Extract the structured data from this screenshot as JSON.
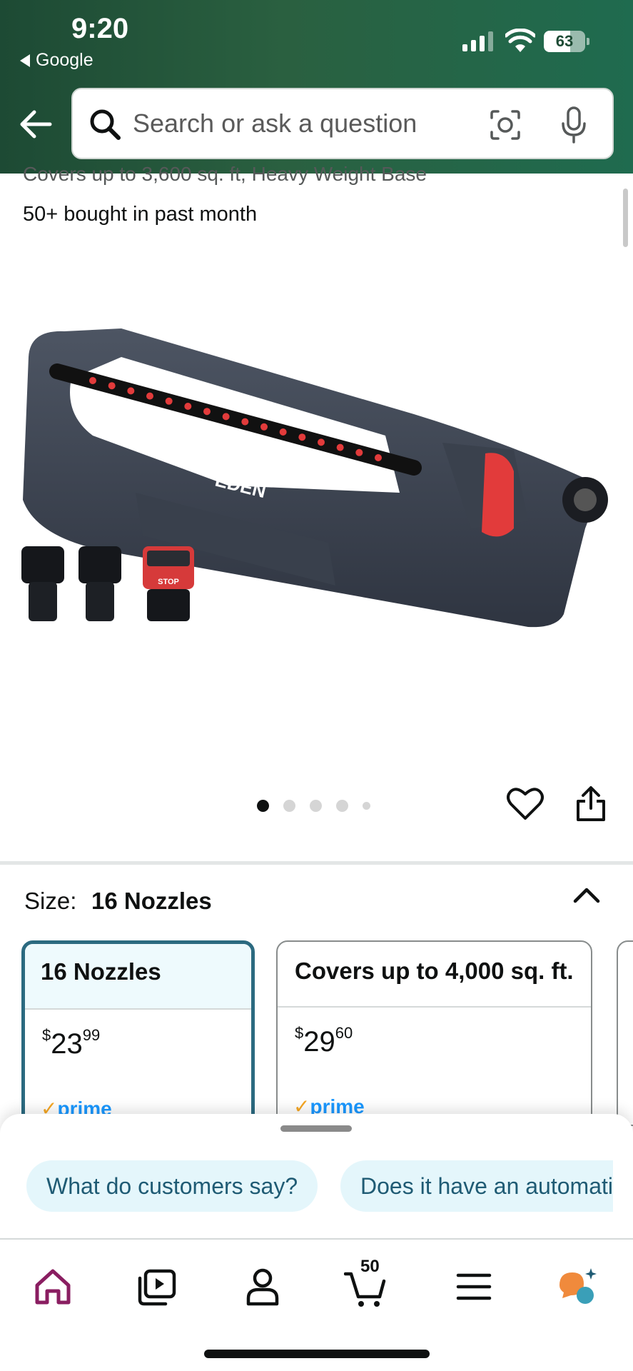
{
  "status_bar": {
    "time": "9:20",
    "back_app": "Google",
    "battery_level": "63",
    "battery_fraction": 0.63,
    "signal_bars_filled": 3
  },
  "search": {
    "placeholder": "Search or ask a question"
  },
  "product": {
    "title_fragment": "Covers up to 3,600 sq. ft, Heavy Weight Base",
    "bought_text": "50+ bought in past month",
    "image_brand": "EDEN",
    "image_badge_text": "STOP",
    "image_count": 5,
    "active_image_index": 0
  },
  "size_selector": {
    "label": "Size:",
    "selected": "16 Nozzles",
    "options": [
      {
        "name": "16 Nozzles",
        "price_whole": "23",
        "price_fraction": "99",
        "currency": "$",
        "prime": "prime",
        "selected": true
      },
      {
        "name": "Covers up to 4,000 sq. ft.",
        "price_whole": "29",
        "price_fraction": "60",
        "currency": "$",
        "prime": "prime",
        "selected": false
      }
    ]
  },
  "suggestions": [
    "What do customers say?",
    "Does it have an automati"
  ],
  "tabbar": {
    "items": [
      "home-icon",
      "video-icon",
      "account-icon",
      "cart-icon",
      "menu-icon",
      "rufus-icon"
    ],
    "cart_count": "50"
  },
  "colors": {
    "header_green": "#1f5a3a",
    "selected_border": "#2b6a80",
    "prime_blue": "#1a98ff",
    "chip_bg": "#e4f6fb",
    "home_active": "#8a1e61"
  }
}
